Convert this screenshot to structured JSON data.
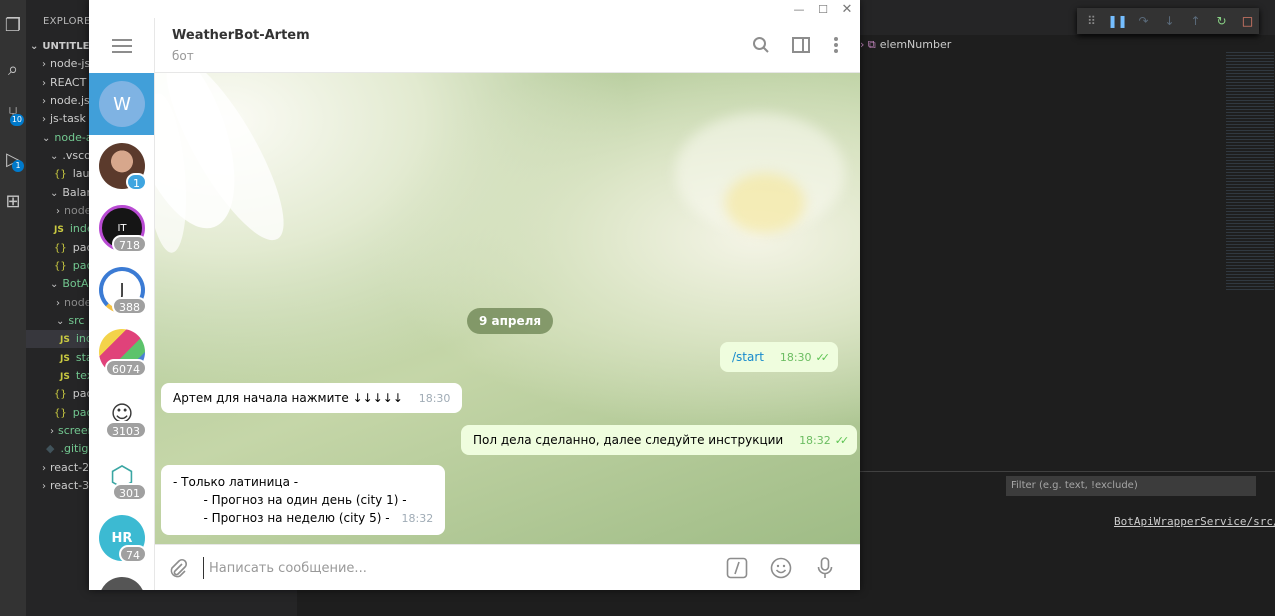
{
  "vscode": {
    "explorer_title": "EXPLORER",
    "badges": {
      "scm": "10",
      "debug": "1"
    },
    "tree": [
      {
        "label": "UNTITLED",
        "kind": "root"
      },
      {
        "label": "node-js",
        "kind": "folder"
      },
      {
        "label": "REACT",
        "kind": "folder"
      },
      {
        "label": "node.js",
        "kind": "folder"
      },
      {
        "label": "js-task",
        "kind": "folder"
      },
      {
        "label": "node-a",
        "kind": "folder-open-green"
      },
      {
        "label": ".vscod",
        "kind": "folder-open"
      },
      {
        "label": "launc",
        "kind": "json"
      },
      {
        "label": "Balanc",
        "kind": "folder-open"
      },
      {
        "label": "node",
        "kind": "folder"
      },
      {
        "label": "inde",
        "kind": "js"
      },
      {
        "label": "pack",
        "kind": "json"
      },
      {
        "label": "pack",
        "kind": "json"
      },
      {
        "label": "BotAp",
        "kind": "folder-open"
      },
      {
        "label": "node",
        "kind": "folder"
      },
      {
        "label": "src",
        "kind": "folder-open"
      },
      {
        "label": "inde",
        "kind": "js"
      },
      {
        "label": "sta",
        "kind": "js"
      },
      {
        "label": "tex",
        "kind": "js"
      },
      {
        "label": "pack",
        "kind": "json"
      },
      {
        "label": "pack",
        "kind": "json"
      },
      {
        "label": "screen",
        "kind": "folder"
      },
      {
        "label": ".gitign",
        "kind": "git"
      },
      {
        "label": "react-2",
        "kind": "folder"
      },
      {
        "label": "react-3",
        "kind": "folder"
      }
    ],
    "breadcrumb": "elemNumber",
    "filter_placeholder": "Filter (e.g. text, !exclude)",
    "console_link": "BotApiWrapperService/src/"
  },
  "telegram": {
    "chat_title": "WeatherBot-Artem",
    "chat_status": "бот",
    "input_placeholder": "Написать сообщение...",
    "chats": [
      {
        "avatar": "W",
        "color": "#7fb3e3",
        "count": null,
        "active": true
      },
      {
        "avatar": "",
        "color": "#7a5a4a",
        "count": "1",
        "count_style": "blue"
      },
      {
        "avatar": "IT",
        "color": "#151515",
        "count": "718"
      },
      {
        "avatar": "J",
        "color": "#ffffff",
        "count": "388"
      },
      {
        "avatar": "",
        "color": "#e8b64b",
        "count": "6074"
      },
      {
        "avatar": "",
        "color": "#ffffff",
        "count": "3103"
      },
      {
        "avatar": "",
        "color": "#ffffff",
        "count": "301"
      },
      {
        "avatar": "HR",
        "color": "#3cbad2",
        "count": "74"
      }
    ],
    "date_separator": "9 апреля",
    "messages": [
      {
        "dir": "out",
        "text": "/start",
        "time": "18:30",
        "command": true
      },
      {
        "dir": "in",
        "text": "Артем  для начала нажмите ↓↓↓↓↓",
        "time": "18:30"
      },
      {
        "dir": "out",
        "text": "Пол дела сделанно, далее следуйте инструкции",
        "time": "18:32"
      },
      {
        "dir": "in",
        "lines": [
          "- Только латиница -",
          "        - Прогноз на один день (city 1) -",
          "        - Прогноз на неделю (city 5) -"
        ],
        "time": "18:32"
      }
    ]
  }
}
